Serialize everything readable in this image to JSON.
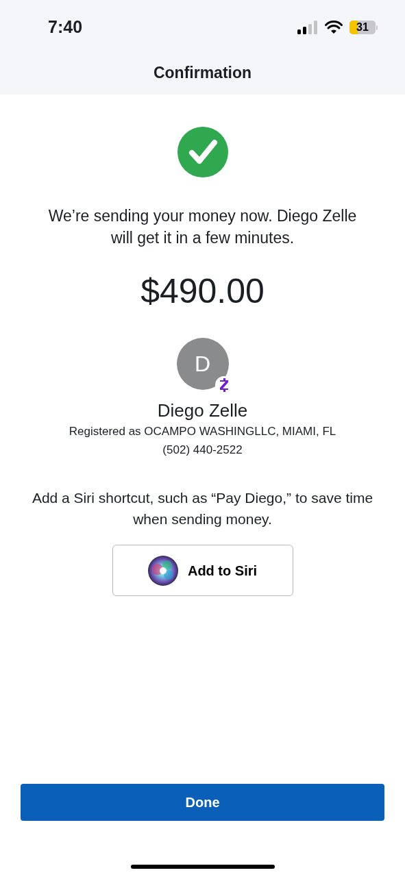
{
  "status_bar": {
    "time": "7:40",
    "battery": "31"
  },
  "header": {
    "title": "Confirmation"
  },
  "message": "We’re sending your money now. Diego Zelle will get it in a few minutes.",
  "amount": "$490.00",
  "recipient": {
    "initial": "D",
    "name": "Diego Zelle",
    "registered": "Registered as OCAMPO WASHINGLLC, MIAMI, FL",
    "phone": "(502) 440-2522"
  },
  "siri_hint": "Add a Siri shortcut, such as “Pay Diego,” to save time when sending money.",
  "siri_button": "Add to Siri",
  "done_button": "Done"
}
